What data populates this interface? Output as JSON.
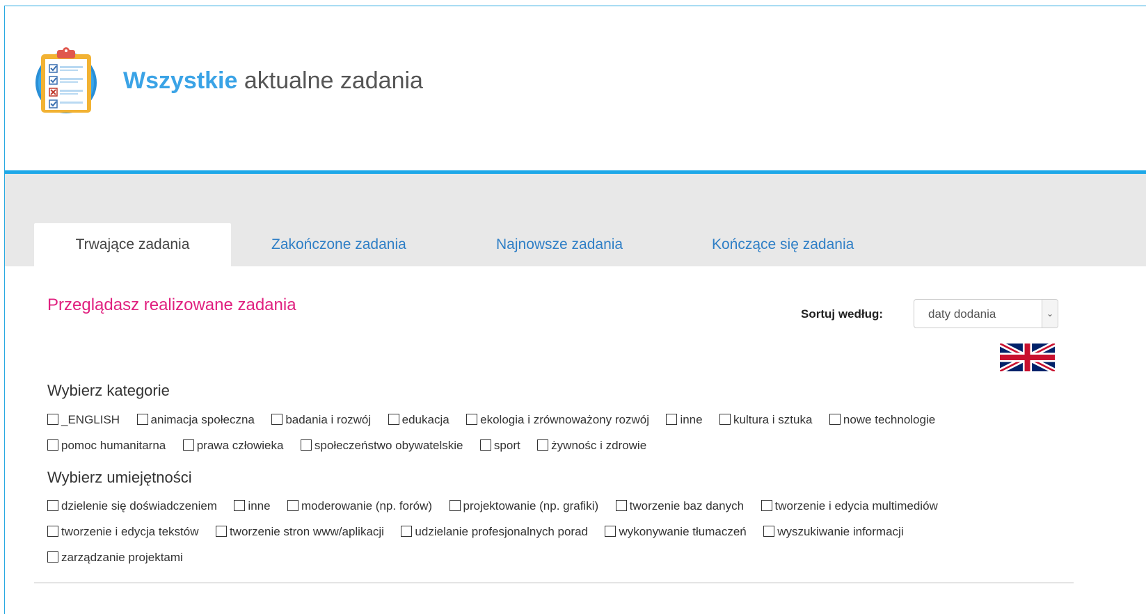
{
  "header": {
    "title_highlight": "Wszystkie",
    "title_rest": " aktualne zadania"
  },
  "tabs": [
    {
      "label": "Trwające zadania",
      "active": true
    },
    {
      "label": "Zakończone zadania",
      "active": false
    },
    {
      "label": "Najnowsze zadania",
      "active": false
    },
    {
      "label": "Kończące się zadania",
      "active": false
    }
  ],
  "content": {
    "subtitle": "Przeglądasz realizowane zadania",
    "sort": {
      "label": "Sortuj według:",
      "selected": "daty dodania"
    },
    "language_flag": "uk-flag-icon"
  },
  "categories": {
    "heading": "Wybierz kategorie",
    "items": [
      "_ENGLISH",
      "animacja społeczna",
      "badania i rozwój",
      "edukacja",
      "ekologia i zrównoważony rozwój",
      "inne",
      "kultura i sztuka",
      "nowe technologie",
      "pomoc humanitarna",
      "prawa człowieka",
      "społeczeństwo obywatelskie",
      "sport",
      "żywnośc i zdrowie"
    ]
  },
  "skills": {
    "heading": "Wybierz umiejętności",
    "items": [
      "dzielenie się doświadczeniem",
      "inne",
      "moderowanie (np. forów)",
      "projektowanie (np. grafiki)",
      "tworzenie baz danych",
      "tworzenie i edycia multimediów",
      "tworzenie i edycja tekstów",
      "tworzenie stron www/aplikacji",
      "udzielanie profesjonalnych porad",
      "wykonywanie tłumaczeń",
      "wyszukiwanie informacji",
      "zarządzanie projektami"
    ]
  },
  "colors": {
    "accent_blue": "#1ea8e8",
    "title_blue": "#3aa3e6",
    "tab_link": "#2f7fc6",
    "subtitle_pink": "#e0207f"
  }
}
